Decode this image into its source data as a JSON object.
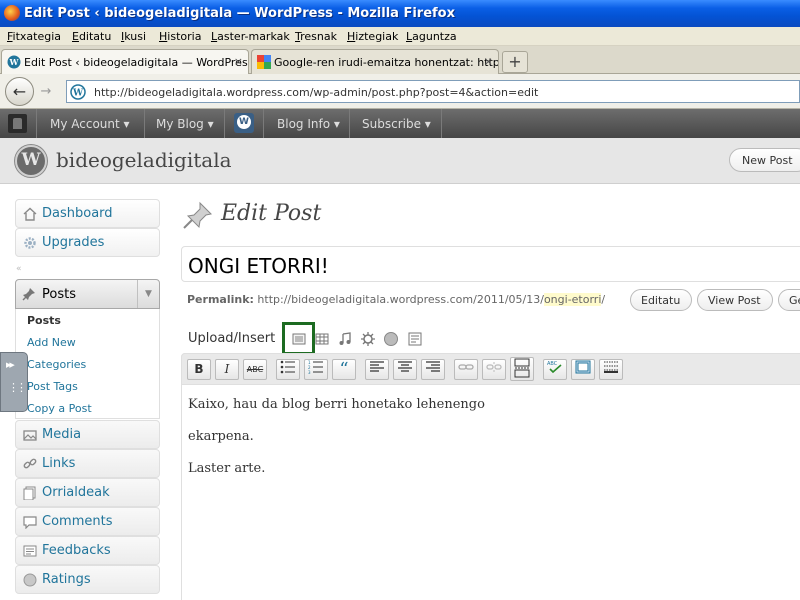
{
  "window": {
    "title": "Edit Post ‹ bideogeladigitala — WordPress - Mozilla Firefox"
  },
  "menubar": {
    "items": [
      "Fitxategia",
      "Editatu",
      "Ikusi",
      "Historia",
      "Laster-markak",
      "Tresnak",
      "Hiztegiak",
      "Laguntza"
    ]
  },
  "tabs": [
    {
      "label": "Edit Post ‹ bideogeladigitala — WordPress",
      "icon": "wordpress-icon",
      "active": true,
      "close": "×"
    },
    {
      "label": "Google-ren irudi-emaitza honentzat: http...",
      "icon": "google-icon",
      "active": false,
      "close": "×"
    }
  ],
  "newtab": {
    "label": "+"
  },
  "navbar": {
    "back": "←",
    "forward": "→",
    "url": "http://bideogeladigitala.wordpress.com/wp-admin/post.php?post=4&action=edit"
  },
  "adminbar": {
    "my_account": "My Account ▾",
    "my_blog": "My Blog ▾",
    "blog_info": "Blog Info ▾",
    "subscribe": "Subscribe ▾"
  },
  "header": {
    "site_name": "bideogeladigitala",
    "new_post": "New Post"
  },
  "sidebar": {
    "top": [
      {
        "label": "Dashboard",
        "icon": "house-icon"
      },
      {
        "label": "Upgrades",
        "icon": "gear-icon"
      }
    ],
    "collapse": "«",
    "posts": {
      "label": "Posts",
      "toggle": "▼",
      "submenu": [
        "Posts",
        "Add New",
        "Categories",
        "Post Tags",
        "Copy a Post"
      ]
    },
    "items": [
      {
        "label": "Media",
        "icon": "media-icon"
      },
      {
        "label": "Links",
        "icon": "link-icon"
      },
      {
        "label": "Orrialdeak",
        "icon": "pages-icon"
      },
      {
        "label": "Comments",
        "icon": "comments-icon"
      },
      {
        "label": "Feedbacks",
        "icon": "feedback-icon"
      },
      {
        "label": "Ratings",
        "icon": "ratings-icon"
      }
    ]
  },
  "main": {
    "page_title": "Edit Post",
    "post_title": "ONGI ETORRI!",
    "permalink": {
      "label": "Permalink:",
      "base": "http://bideogeladigitala.wordpress.com/2011/05/13/",
      "slug": "ongi-etorri",
      "trail": "/",
      "edit_btn": "Editatu",
      "view_btn": "View Post",
      "get_btn": "Get Shortlink"
    },
    "upload_label": "Upload/Insert",
    "toolbar": {
      "bold": "B",
      "italic": "I",
      "strike": "ABC",
      "quote": "“"
    },
    "content": [
      "Kaixo, hau da blog berri honetako lehenengo",
      "ekarpena.",
      "Laster arte."
    ]
  },
  "colors": {
    "link": "#21759b",
    "highlight_box": "#1d6b21",
    "adminbar": "#464646"
  }
}
